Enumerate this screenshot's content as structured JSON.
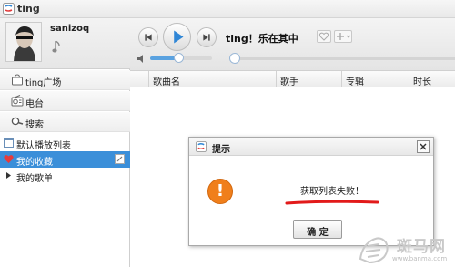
{
  "window": {
    "title": "ting"
  },
  "profile": {
    "username": "sanizoq"
  },
  "sidebar": {
    "nav_items": [
      {
        "label": "ting广场",
        "icon": "bag-icon"
      },
      {
        "label": "电台",
        "icon": "radio-icon"
      },
      {
        "label": "搜索",
        "icon": "search-icon"
      }
    ],
    "lists": [
      {
        "label": "默认播放列表",
        "icon": "playlist-icon",
        "selected": false
      },
      {
        "label": "我的收藏",
        "icon": "heart-icon",
        "selected": true
      },
      {
        "label": "我的歌单",
        "icon": "triangle-icon",
        "selected": false
      }
    ]
  },
  "player": {
    "song_title": "ting！乐在其中",
    "volume_level": 0.45,
    "progress": 0.0
  },
  "table": {
    "columns": [
      "歌曲名",
      "歌手",
      "专辑",
      "时长"
    ]
  },
  "dialog": {
    "title": "提示",
    "message": "获取列表失败！",
    "ok_label": "确 定"
  },
  "watermark": {
    "text": "斑马网",
    "url": "www.banma.com"
  },
  "colors": {
    "selected": "#3b8fd9",
    "warning": "#f07f1b",
    "accent": "#5aa2e0",
    "highlight_line": "#e21a1a"
  }
}
